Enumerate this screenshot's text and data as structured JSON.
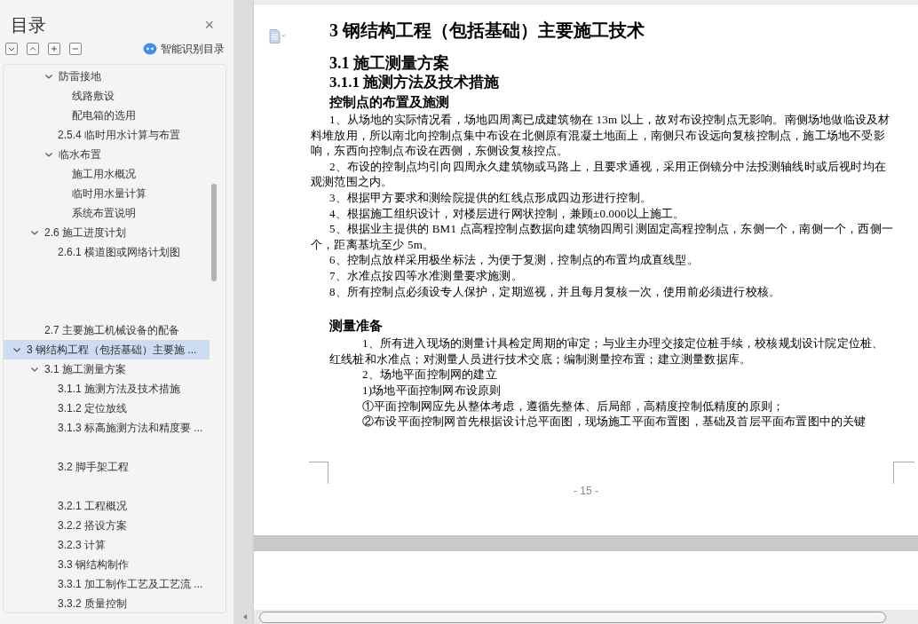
{
  "sidebar": {
    "title": "目录",
    "close": "×",
    "smart_button": "智能识别目录",
    "toc": [
      {
        "children": [
          {
            "children": [
              {
                "label": "防雷接地",
                "expanded": true,
                "selected": false,
                "children": [
                  {
                    "label": "线路敷设",
                    "selected": false
                  },
                  {
                    "label": "配电箱的选用",
                    "selected": false
                  }
                ]
              },
              {
                "label": "2.5.4 临时用水计算与布置",
                "selected": false
              },
              {
                "label": "临水布置",
                "expanded": true,
                "selected": false,
                "children": [
                  {
                    "label": "施工用水概况",
                    "selected": false
                  },
                  {
                    "label": "临时用水量计算",
                    "selected": false
                  },
                  {
                    "label": "系统布置说明",
                    "selected": false
                  }
                ]
              }
            ]
          },
          {
            "label": "2.6 施工进度计划",
            "expanded": true,
            "selected": false,
            "children": [
              {
                "label": "2.6.1 横道图或网络计划图",
                "selected": false
              },
              {
                "kind": "blank"
              },
              {
                "kind": "blank"
              },
              {
                "kind": "blank"
              }
            ]
          },
          {
            "label": "2.7 主要施工机械设备的配备",
            "selected": false
          }
        ]
      },
      {
        "label": "3 钢结构工程（包括基础）主要施 ...",
        "expanded": true,
        "selected": true,
        "children": [
          {
            "label": "3.1 施工测量方案",
            "expanded": true,
            "selected": false,
            "children": [
              {
                "label": "3.1.1 施测方法及技术措施",
                "selected": false
              },
              {
                "label": "3.1.2 定位放线",
                "selected": false
              },
              {
                "label": "3.1.3 标高施测方法和精度要 ...",
                "selected": false
              },
              {
                "kind": "blank"
              },
              {
                "label": "3.2 脚手架工程",
                "selected": false
              },
              {
                "kind": "blank"
              },
              {
                "label": "3.2.1 工程概况",
                "selected": false
              },
              {
                "label": "3.2.2 搭设方案",
                "selected": false
              },
              {
                "label": "3.2.3 计算",
                "selected": false
              },
              {
                "label": "3.3 钢结构制作",
                "selected": false
              },
              {
                "label": "3.3.1 加工制作工艺及工艺流 ...",
                "selected": false
              },
              {
                "label": "3.3.2 质量控制",
                "selected": false
              }
            ]
          }
        ]
      }
    ]
  },
  "document": {
    "page_number": "- 15 -",
    "blocks": [
      {
        "kind": "h1",
        "text": "3 钢结构工程（包括基础）主要施工技术"
      },
      {
        "kind": "h2",
        "text": "3.1 施工测量方案"
      },
      {
        "kind": "h3",
        "text": "3.1.1 施测方法及技术措施"
      },
      {
        "kind": "h4",
        "text": "控制点的布置及施测"
      },
      {
        "kind": "numbered",
        "text": "1、从场地的实际情况看，场地四周离已成建筑物在 13m 以上，故对布设控制点无影响。南侧场地做临设及材料堆放用，所以南北向控制点集中布设在北侧原有混凝土地面上，南侧只布设远向复核控制点，施工场地不受影响，东西向控制点布设在西侧，东侧设复核控点。"
      },
      {
        "kind": "numbered",
        "text": "2、布设的控制点均引向四周永久建筑物或马路上，且要求通视，采用正倒镜分中法投测轴线时或后视时均在观测范围之内。"
      },
      {
        "kind": "numbered",
        "text": "3、根据甲方要求和测绘院提供的红线点形成四边形进行控制。"
      },
      {
        "kind": "numbered",
        "text": "4、根据施工组织设计，对楼层进行网状控制，兼顾±0.000以上施工。"
      },
      {
        "kind": "numbered",
        "text": "5、根据业主提供的 BM1 点高程控制点数据向建筑物四周引测固定高程控制点，东侧一个，南侧一个，西侧一个，距离基坑至少 5m。"
      },
      {
        "kind": "numbered",
        "text": "6、控制点放样采用极坐标法，为便于复测，控制点的布置均成直线型。"
      },
      {
        "kind": "numbered",
        "text": "7、水准点按四等水准测量要求施测。"
      },
      {
        "kind": "numbered",
        "text": "8、所有控制点必须设专人保护，定期巡视，并且每月复核一次，使用前必须进行校核。"
      },
      {
        "kind": "blank"
      },
      {
        "kind": "h4",
        "text": "测量准备"
      },
      {
        "kind": "indented",
        "text": "1、所有进入现场的测量计具检定周期的审定；与业主办理交接定位桩手续，校核规划设计院定位桩、红线桩和水准点；对测量人员进行技术交底；编制测量控布置；建立测量数据库。"
      },
      {
        "kind": "indented",
        "text": "2、场地平面控制网的建立"
      },
      {
        "kind": "indented",
        "text": "1)场地平面控制网布设原则"
      },
      {
        "kind": "indented",
        "text": "①平面控制网应先从整体考虑，遵循先整体、后局部，高精度控制低精度的原则；"
      },
      {
        "kind": "indented",
        "text": "②布设平面控制网首先根据设计总平面图，现场施工平面布置图，基础及首层平面布置图中的关键"
      }
    ]
  }
}
